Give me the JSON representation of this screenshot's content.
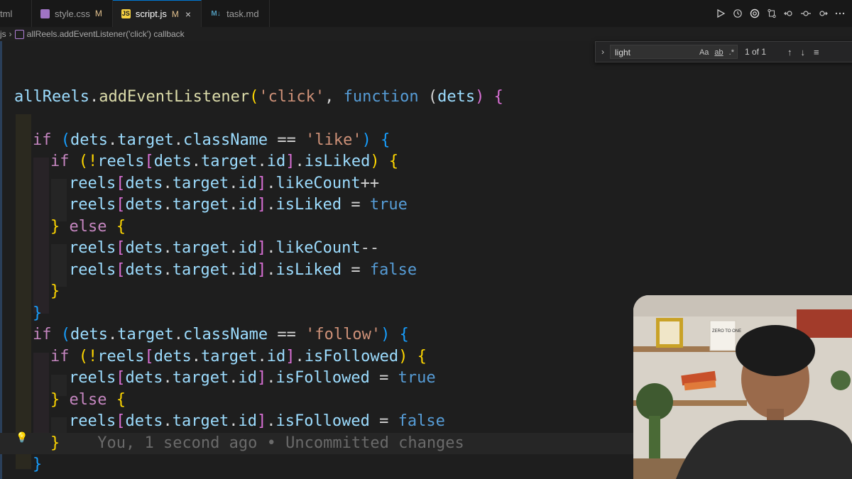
{
  "tabs": [
    {
      "label": "tml",
      "type": "html"
    },
    {
      "label": "style.css",
      "status": "M",
      "type": "css"
    },
    {
      "label": "script.js",
      "status": "M",
      "type": "js",
      "active": true
    },
    {
      "label": "task.md",
      "type": "md"
    }
  ],
  "tab_close_glyph": "×",
  "toolbar_icons": [
    "run-icon",
    "history-icon",
    "openai-icon",
    "compare-icon",
    "back-icon",
    "circle-icon",
    "forward-icon",
    "more-icon"
  ],
  "breadcrumb": {
    "file": "js",
    "separator": "›",
    "symbol": "allReels.addEventListener('click') callback"
  },
  "find": {
    "query": "light",
    "match_case": "Aa",
    "whole_word": "ab",
    "regex": ".*",
    "result": "1 of 1"
  },
  "code": {
    "l1": {
      "a": "allReels",
      "b": ".",
      "c": "addEventListener",
      "d": "(",
      "e": "'click'",
      "f": ", ",
      "g": "function",
      "h": " (",
      "i": "dets",
      "j": ") ",
      "k": "{"
    },
    "l3": {
      "a": "if",
      "b": " (",
      "c": "dets",
      "d": ".",
      "e": "target",
      "f": ".",
      "g": "className",
      "h": " == ",
      "i": "'like'",
      "j": ") ",
      "k": "{"
    },
    "l4": {
      "a": "if",
      "b": " (!",
      "c": "reels",
      "d": "[",
      "e": "dets",
      "f": ".",
      "g": "target",
      "h": ".",
      "i": "id",
      "j": "]",
      "k": ".",
      "l": "isLiked",
      "m": ") ",
      "n": "{"
    },
    "l5": {
      "a": "reels",
      "b": "[",
      "c": "dets",
      "d": ".",
      "e": "target",
      "f": ".",
      "g": "id",
      "h": "]",
      "i": ".",
      "j": "likeCount",
      "k": "++"
    },
    "l6": {
      "a": "reels",
      "b": "[",
      "c": "dets",
      "d": ".",
      "e": "target",
      "f": ".",
      "g": "id",
      "h": "]",
      "i": ".",
      "j": "isLiked",
      "k": " = ",
      "l": "true"
    },
    "l7": {
      "a": "}",
      "b": " else ",
      "c": "{"
    },
    "l8": {
      "a": "reels",
      "b": "[",
      "c": "dets",
      "d": ".",
      "e": "target",
      "f": ".",
      "g": "id",
      "h": "]",
      "i": ".",
      "j": "likeCount",
      "k": "--"
    },
    "l9": {
      "a": "reels",
      "b": "[",
      "c": "dets",
      "d": ".",
      "e": "target",
      "f": ".",
      "g": "id",
      "h": "]",
      "i": ".",
      "j": "isLiked",
      "k": " = ",
      "l": "false"
    },
    "l10": {
      "a": "}"
    },
    "l11": {
      "a": "}"
    },
    "l12": {
      "a": "if",
      "b": " (",
      "c": "dets",
      "d": ".",
      "e": "target",
      "f": ".",
      "g": "className",
      "h": " == ",
      "i": "'follow'",
      "j": ") ",
      "k": "{"
    },
    "l13": {
      "a": "if",
      "b": " (!",
      "c": "reels",
      "d": "[",
      "e": "dets",
      "f": ".",
      "g": "target",
      "h": ".",
      "i": "id",
      "j": "]",
      "k": ".",
      "l": "isFollowed",
      "m": ") ",
      "n": "{"
    },
    "l14": {
      "a": "reels",
      "b": "[",
      "c": "dets",
      "d": ".",
      "e": "target",
      "f": ".",
      "g": "id",
      "h": "]",
      "i": ".",
      "j": "isFollowed",
      "k": " = ",
      "l": "true"
    },
    "l15": {
      "a": "}",
      "b": " else ",
      "c": "{"
    },
    "l16": {
      "a": "reels",
      "b": "[",
      "c": "dets",
      "d": ".",
      "e": "target",
      "f": ".",
      "g": "id",
      "h": "]",
      "i": ".",
      "j": "isFollowed",
      "k": " = ",
      "l": "false"
    },
    "l17": {
      "a": "}",
      "blame": "You, 1 second ago • Uncommitted changes"
    },
    "l18": {
      "a": "}"
    }
  },
  "lightbulb": "💡",
  "colors": {
    "accent": "#0078d4",
    "keyword": "#569cd6",
    "string": "#ce9178",
    "variable": "#9cdcfe",
    "function": "#dcdcaa",
    "modified": "#e2c08d"
  },
  "webcam": {
    "shelf_book_title": "ZERO TO ONE"
  }
}
